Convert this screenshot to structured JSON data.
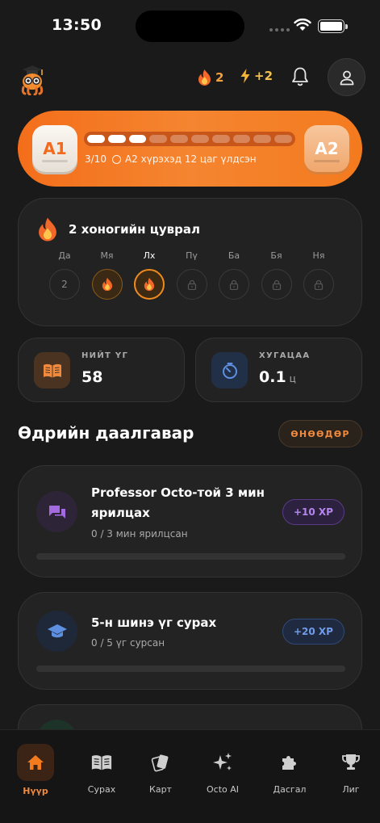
{
  "status_bar": {
    "time": "13:50"
  },
  "header": {
    "streak_count": "2",
    "xp_gain": "+2"
  },
  "level": {
    "current": "A1",
    "next": "A2",
    "progress_text": "3/10",
    "progress_done": 3,
    "progress_total": 10,
    "time_left_text": "A2 хүрэхэд 12 цаг үлдсэн"
  },
  "streak": {
    "title": "2 хоногийн цуврал",
    "days": [
      {
        "label": "Да",
        "state": "missed",
        "content": "2"
      },
      {
        "label": "Мя",
        "state": "done"
      },
      {
        "label": "Лх",
        "state": "today"
      },
      {
        "label": "Пү",
        "state": "locked"
      },
      {
        "label": "Ба",
        "state": "locked"
      },
      {
        "label": "Бя",
        "state": "locked"
      },
      {
        "label": "Ня",
        "state": "locked"
      }
    ]
  },
  "stats": {
    "words_label": "НИЙТ ҮГ",
    "words_value": "58",
    "time_label": "ХУГАЦАА",
    "time_value": "0.1",
    "time_unit": "ц"
  },
  "daily": {
    "title": "Өдрийн даалгавар",
    "filter": "ӨНӨӨДӨР",
    "tasks": [
      {
        "title": "Professor Octo-той 3 мин ярилцах",
        "progress": "0 / 3 мин ярилцсан",
        "xp": "+10 XP",
        "fraction": 0
      },
      {
        "title": "5-н шинэ үг сурах",
        "progress": "0 / 5 үг сурсан",
        "xp": "+20 XP",
        "fraction": 0
      }
    ]
  },
  "nav": [
    {
      "label": "Нүүр",
      "icon": "home-icon",
      "active": true
    },
    {
      "label": "Сурах",
      "icon": "book-icon"
    },
    {
      "label": "Карт",
      "icon": "cards-icon"
    },
    {
      "label": "Octo AI",
      "icon": "sparkles-icon"
    },
    {
      "label": "Дасгал",
      "icon": "puzzle-icon"
    },
    {
      "label": "Лиг",
      "icon": "trophy-icon"
    }
  ],
  "colors": {
    "accent": "#f47a1e",
    "purple": "#b585ee",
    "blue": "#6f9be8",
    "background": "#1a1a1a"
  }
}
